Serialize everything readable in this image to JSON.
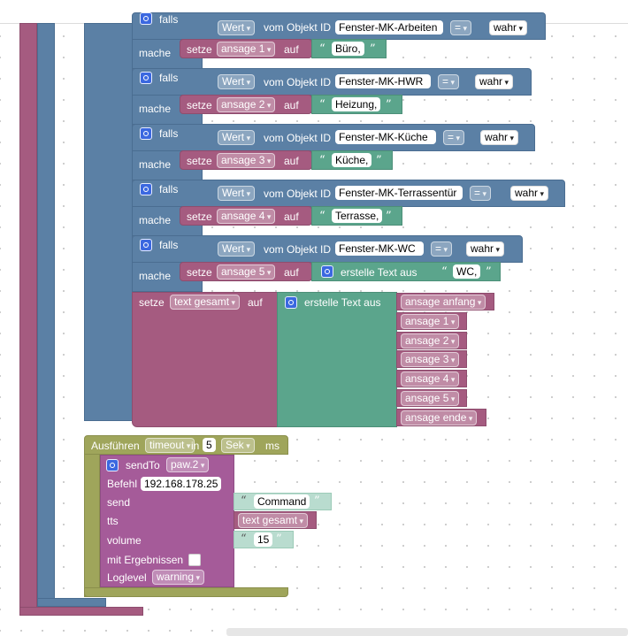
{
  "colors": {
    "logic": "#5b80a5",
    "variables": "#a55b80",
    "text": "#5ba58c",
    "timeout": "#9fa55b",
    "sendto": "#a55b99"
  },
  "falls_label": "falls",
  "mache_label": "mache",
  "setze_label": "setze",
  "auf_label": "auf",
  "wert_label": "Wert",
  "vom_label": "vom Objekt ID",
  "eq_label": "=",
  "erstelle_label": "erstelle Text aus",
  "rows": [
    {
      "id": "Fenster-MK-Arbeiten",
      "val": "wahr",
      "var": "ansage 1",
      "txt": "Büro,"
    },
    {
      "id": "Fenster-MK-HWR",
      "val": "wahr",
      "var": "ansage 2",
      "txt": "Heizung,"
    },
    {
      "id": "Fenster-MK-Küche",
      "val": "wahr",
      "var": "ansage 3",
      "txt": "Küche,"
    },
    {
      "id": "Fenster-MK-Terrassentür",
      "val": "wahr",
      "var": "ansage 4",
      "txt": "Terrasse,"
    },
    {
      "id": "Fenster-MK-WC",
      "val": "wahr",
      "var": "ansage 5",
      "txt": "WC,"
    }
  ],
  "gesamt": {
    "var": "text gesamt",
    "items": [
      "ansage anfang",
      "ansage 1",
      "ansage 2",
      "ansage 3",
      "ansage 4",
      "ansage 5",
      "ansage ende"
    ]
  },
  "timeout": {
    "label": "Ausführen",
    "var": "timeout",
    "in": "in",
    "value": "5",
    "unit": "Sek",
    "ms": "ms"
  },
  "sendto": {
    "label": "sendTo",
    "instance": "paw.2",
    "befehl_label": "Befehl",
    "befehl": "192.168.178.25",
    "send_label": "send",
    "send": "Command",
    "tts_label": "tts",
    "tts": "text gesamt",
    "volume_label": "volume",
    "volume": "15",
    "ergebnisse_label": "mit Ergebnissen",
    "loglevel_label": "Loglevel",
    "loglevel": "warning"
  }
}
